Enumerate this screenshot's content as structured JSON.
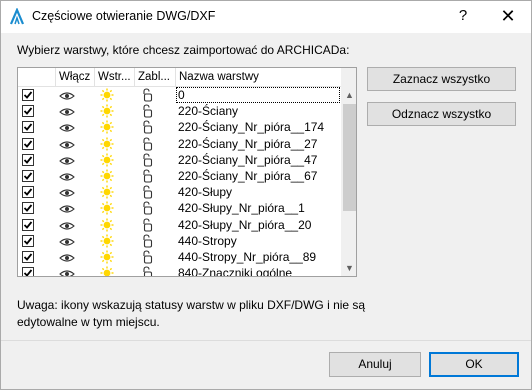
{
  "window": {
    "title": "Częściowe otwieranie DWG/DXF",
    "help_label": "?",
    "close_label": "✕"
  },
  "instruction": "Wybierz warstwy, które chcesz zaimportować do ARCHICADa:",
  "grid": {
    "columns": [
      "Włącz",
      "Wstr...",
      "Zabl...",
      "Nazwa warstwy"
    ],
    "rows": [
      {
        "checked": true,
        "name": "0"
      },
      {
        "checked": true,
        "name": "220-Ściany"
      },
      {
        "checked": true,
        "name": "220-Ściany_Nr_pióra__174"
      },
      {
        "checked": true,
        "name": "220-Ściany_Nr_pióra__27"
      },
      {
        "checked": true,
        "name": "220-Ściany_Nr_pióra__47"
      },
      {
        "checked": true,
        "name": "220-Ściany_Nr_pióra__67"
      },
      {
        "checked": true,
        "name": "420-Słupy"
      },
      {
        "checked": true,
        "name": "420-Słupy_Nr_pióra__1"
      },
      {
        "checked": true,
        "name": "420-Słupy_Nr_pióra__20"
      },
      {
        "checked": true,
        "name": "440-Stropy"
      },
      {
        "checked": true,
        "name": "440-Stropy_Nr_pióra__89"
      },
      {
        "checked": true,
        "name": "840-Znaczniki ogólne"
      }
    ],
    "icons": {
      "visible": "eye-icon",
      "frozen": "sun-icon",
      "locked": "unlock-icon"
    }
  },
  "buttons": {
    "select_all": "Zaznacz wszystko",
    "deselect_all": "Odznacz wszystko",
    "cancel": "Anuluj",
    "ok": "OK"
  },
  "note": "Uwaga: ikony wskazują statusy warstw w pliku DXF/DWG i nie są edytowalne w tym miejscu.",
  "colors": {
    "accent": "#0078d7",
    "sun": "#ffd700",
    "app_icon": "#1a8ccf"
  }
}
